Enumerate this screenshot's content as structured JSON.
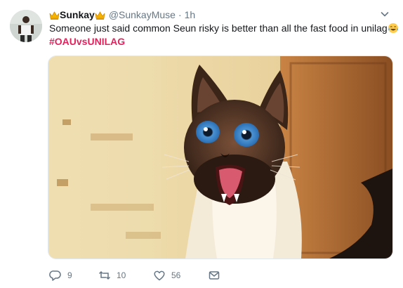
{
  "tweet": {
    "display_name": "Sunkay",
    "handle": "@SunkayMuse",
    "separator": "·",
    "time": "1h",
    "text": "Someone just said common Seun risky is better than all the fast food in unilag",
    "hashtag": "#OAUvsUNILAG",
    "media_description": "cat-shocked-meme"
  },
  "actions": {
    "reply_count": "9",
    "retweet_count": "10",
    "like_count": "56"
  },
  "colors": {
    "hashtag": "#e0245e",
    "secondary_text": "#657786",
    "primary_text": "#14171a"
  }
}
